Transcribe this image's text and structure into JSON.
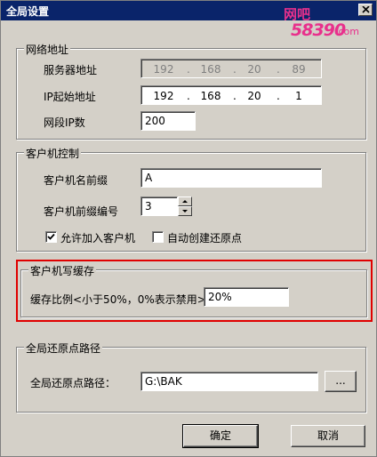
{
  "window": {
    "title": "全局设置"
  },
  "watermark": {
    "line1": "网吧",
    "line2": "58390",
    "line3": ".com"
  },
  "network": {
    "title": "网络地址",
    "server_label": "服务器地址",
    "server_ip": [
      "192",
      "168",
      "20",
      "89"
    ],
    "start_ip_label": "IP起始地址",
    "start_ip": [
      "192",
      "168",
      "20",
      "1"
    ],
    "count_label": "网段IP数",
    "count_value": "200"
  },
  "client": {
    "title": "客户机控制",
    "prefix_label": "客户机名前缀",
    "prefix_value": "A",
    "number_label": "客户机前缀编号",
    "number_value": "3",
    "allow_join_label": "允许加入客户机",
    "allow_join_checked": true,
    "auto_restore_label": "自动创建还原点",
    "auto_restore_checked": false
  },
  "cache": {
    "title": "客户机写缓存",
    "ratio_label": "缓存比例<小于50%，0%表示禁用>:",
    "ratio_value": "20%"
  },
  "restore": {
    "title": "全局还原点路径",
    "path_label": "全局还原点路径：",
    "path_value": "G:\\BAK",
    "browse_label": "..."
  },
  "buttons": {
    "ok": "确定",
    "cancel": "取消"
  },
  "colors": {
    "title_bar": "#0a246a",
    "face": "#d4d0c8",
    "highlight_box": "#e00000",
    "watermark": "#e8308c"
  }
}
